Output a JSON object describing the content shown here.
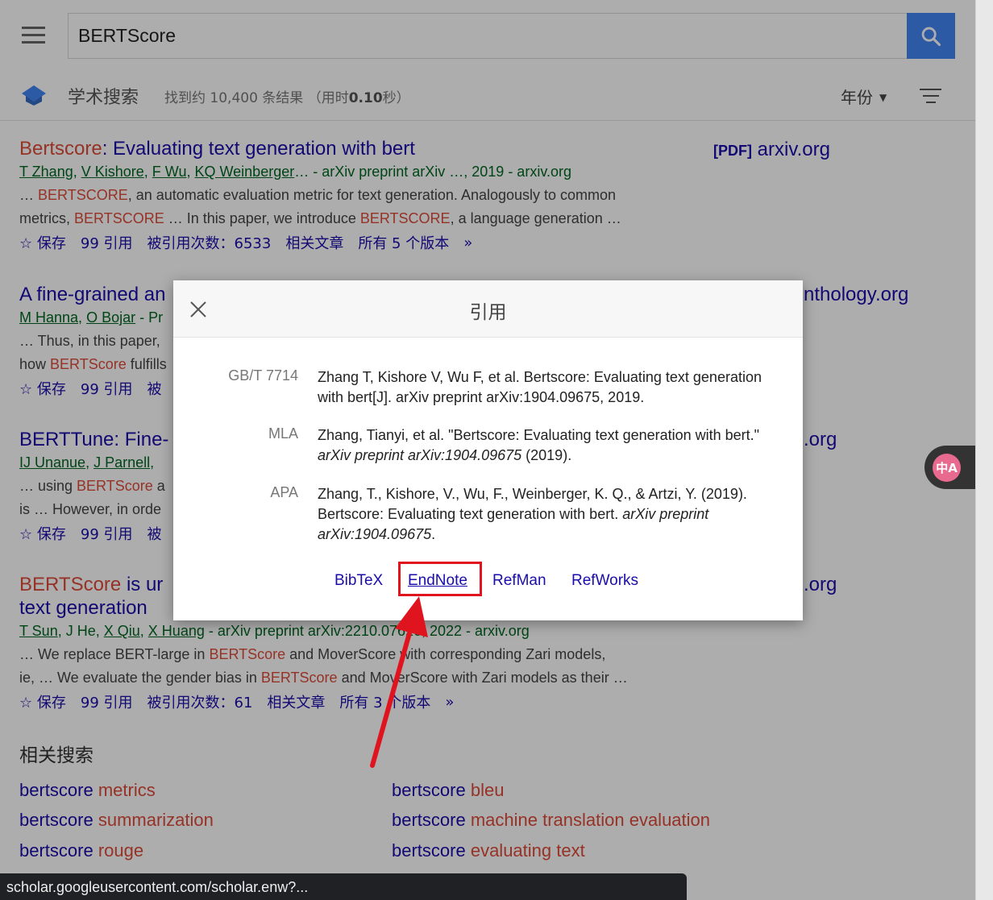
{
  "search": {
    "query": "BERTScore"
  },
  "subbar": {
    "brand": "学术搜索",
    "count_prefix": "找到约 10,400 条结果 （用时",
    "count_time": "0.10",
    "count_suffix": "秒）",
    "year_label": "年份"
  },
  "results": [
    {
      "title_hl": "Bertscore",
      "title_rest": ": Evaluating text generation with bert",
      "authors": [
        "T Zhang",
        "V Kishore",
        "F Wu",
        "KQ Weinberger"
      ],
      "source": "… - arXiv preprint arXiv …, 2019 - arxiv.org",
      "snippet_1a": "… ",
      "snippet_1b": "BERTSCORE",
      "snippet_1c": ", an automatic evaluation metric for text generation. Analogously to common",
      "snippet_2a": "metrics, ",
      "snippet_2b": "BERTSCORE",
      "snippet_2c": " … In this paper, we introduce ",
      "snippet_2d": "BERTSCORE",
      "snippet_2e": ", a language generation …",
      "save": "保存",
      "cite": "引用",
      "cited_by": "被引用次数：6533",
      "related": "相关文章",
      "versions": "所有 5 个版本",
      "side_tag": "[PDF]",
      "side_site": "arxiv.org"
    },
    {
      "title": "A fine-grained an",
      "authors": [
        "M Hanna",
        "O Bojar"
      ],
      "source": " - Pr",
      "snippet_1": "… Thus, in this paper,",
      "snippet_2a": "how ",
      "snippet_2b": "BERTScore",
      "snippet_2c": " fulfills",
      "save": "保存",
      "cite": "引用",
      "cited_by": "被",
      "side_site": "nthology.org"
    },
    {
      "title": "BERTTune: Fine-",
      "authors": [
        "IJ Unanue",
        "J Parnell"
      ],
      "source": "",
      "snippet_1a": "… using ",
      "snippet_1b": "BERTScore",
      "snippet_1c": " a",
      "snippet_2": "is … However, in orde",
      "save": "保存",
      "cite": "引用",
      "cited_by": "被",
      "side_site": ".org"
    },
    {
      "title_hl": "BERTScore",
      "title_rest": " is ur",
      "title_line2": "text generation",
      "authors": [
        "T Sun",
        "J He",
        "X Qiu",
        "X Huang"
      ],
      "source": " - arXiv preprint arXiv:2210.07626, 2022 - arxiv.org",
      "snippet_1a": "… We replace BERT-large in ",
      "snippet_1b": "BERTScore",
      "snippet_1c": " and MoverScore with corresponding Zari models,",
      "snippet_2a": "ie, … We evaluate the gender bias in ",
      "snippet_2b": "BERTScore",
      "snippet_2c": " and MoverScore with Zari models as their …",
      "save": "保存",
      "cite": "引用",
      "cited_by": "被引用次数：61",
      "related": "相关文章",
      "versions": "所有 3 个版本",
      "side_site": ".org"
    }
  ],
  "related_searches": {
    "heading": "相关搜索",
    "items": [
      {
        "base": "bertscore",
        "extra": " metrics"
      },
      {
        "base": "bertscore",
        "extra": " bleu"
      },
      {
        "base": "bertscore",
        "extra": " summarization"
      },
      {
        "base": "bertscore",
        "extra": " machine translation evaluation"
      },
      {
        "base": "bertscore",
        "extra": " rouge"
      },
      {
        "base": "bertscore",
        "extra": " evaluating text"
      }
    ]
  },
  "dialog": {
    "title": "引用",
    "citations": [
      {
        "label": "GB/T 7714",
        "text": "Zhang T, Kishore V, Wu F, et al. Bertscore: Evaluating text generation with bert[J]. arXiv preprint arXiv:1904.09675, 2019."
      },
      {
        "label": "MLA",
        "text_a": "Zhang, Tianyi, et al. \"Bertscore: Evaluating text generation with bert.\" ",
        "text_i": "arXiv preprint arXiv:1904.09675",
        "text_b": " (2019)."
      },
      {
        "label": "APA",
        "text_a": "Zhang, T., Kishore, V., Wu, F., Weinberger, K. Q., & Artzi, Y. (2019). Bertscore: Evaluating text generation with bert. ",
        "text_i": "arXiv preprint arXiv:1904.09675",
        "text_b": "."
      }
    ],
    "exports": [
      "BibTeX",
      "EndNote",
      "RefMan",
      "RefWorks"
    ]
  },
  "translate_label": "中A",
  "status_url": "scholar.googleusercontent.com/scholar.enw?...",
  "colors": {
    "link": "#1a0dab",
    "highlight": "#dd4b39",
    "author": "#006621",
    "search_button": "#4285f4",
    "annotation": "#e0141e"
  }
}
